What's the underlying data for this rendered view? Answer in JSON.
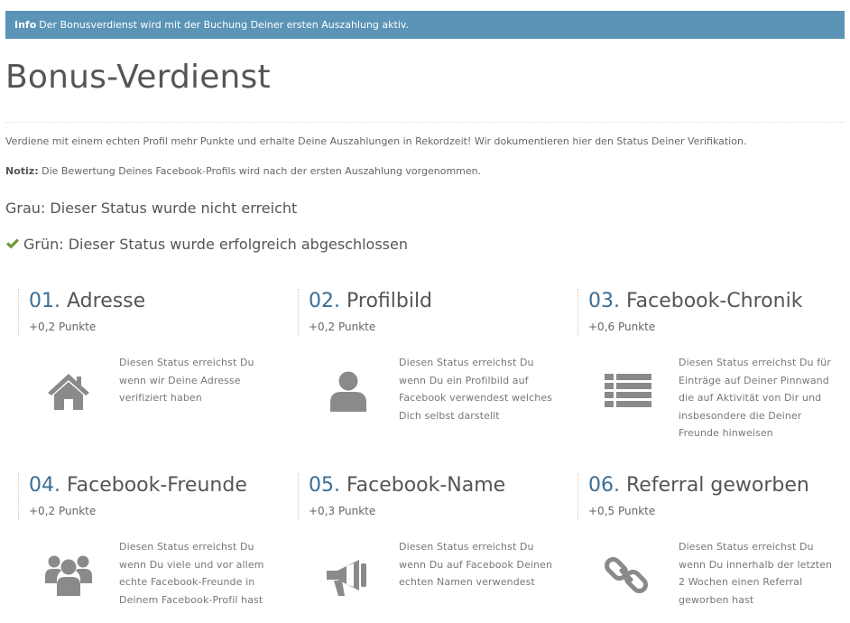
{
  "info": {
    "label": "Info",
    "text": "Der Bonusverdienst wird mit der Buchung Deiner ersten Auszahlung aktiv."
  },
  "page": {
    "title": "Bonus-Verdienst",
    "intro": "Verdiene mit einem echten Profil mehr Punkte und erhalte Deine Auszahlungen in Rekordzeit! Wir dokumentieren hier den Status Deiner Verifikation.",
    "note_label": "Notiz:",
    "note_text": "Die Bewertung Deines Facebook-Profils wird nach der ersten Auszahlung vorgenommen."
  },
  "legend": {
    "grey": "Grau: Dieser Status wurde nicht erreicht",
    "green": "Grün: Dieser Status wurde erfolgreich abgeschlossen"
  },
  "colors": {
    "info_bar": "#5b94b6",
    "accent_number": "#3b6e97",
    "check_green": "#6a9a2f",
    "icon_grey": "#8a8a8a"
  },
  "steps": [
    {
      "number": "01.",
      "title": "Adresse",
      "points": "+0,2 Punkte",
      "icon": "home-icon",
      "description": "Diesen Status erreichst Du wenn wir Deine Adresse verifiziert haben"
    },
    {
      "number": "02.",
      "title": "Profilbild",
      "points": "+0,2 Punkte",
      "icon": "user-icon",
      "description": "Diesen Status erreichst Du wenn Du ein Profilbild auf Facebook verwendest welches Dich selbst darstellt"
    },
    {
      "number": "03.",
      "title": "Facebook-Chronik",
      "points": "+0,6 Punkte",
      "icon": "list-icon",
      "description": "Diesen Status erreichst Du für Einträge auf Deiner Pinnwand die auf Aktivität von Dir und insbesondere die Deiner Freunde hinweisen"
    },
    {
      "number": "04.",
      "title": "Facebook-Freunde",
      "points": "+0,2 Punkte",
      "icon": "group-icon",
      "description": "Diesen Status erreichst Du wenn Du viele und vor allem echte Facebook-Freunde in Deinem Facebook-Profil hast"
    },
    {
      "number": "05.",
      "title": "Facebook-Name",
      "points": "+0,3 Punkte",
      "icon": "megaphone-icon",
      "description": "Diesen Status erreichst Du wenn Du auf Facebook Deinen echten Namen verwendest"
    },
    {
      "number": "06.",
      "title": "Referral geworben",
      "points": "+0,5 Punkte",
      "icon": "link-icon",
      "description": "Diesen Status erreichst Du wenn Du innerhalb der letzten 2 Wochen einen Referral geworben hast"
    }
  ]
}
